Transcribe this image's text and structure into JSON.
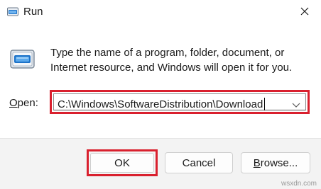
{
  "window": {
    "title": "Run",
    "title_icon": "run-icon",
    "close_icon": "close-icon"
  },
  "main": {
    "description": "Type the name of a program, folder, document, or Internet resource, and Windows will open it for you.",
    "open_label_underlined": "O",
    "open_label_rest": "pen:",
    "input_value": "C:\\Windows\\SoftwareDistribution\\Download",
    "dropdown_icon": "chevron-down-icon"
  },
  "footer": {
    "ok_label": "OK",
    "cancel_label": "Cancel",
    "browse_label_underlined": "B",
    "browse_label_rest": "rowse..."
  },
  "watermark": "wsxdn.com",
  "colors": {
    "highlight": "#d9202e",
    "icon_blue": "#1e73c8",
    "footer_bg": "#f3f3f3"
  }
}
